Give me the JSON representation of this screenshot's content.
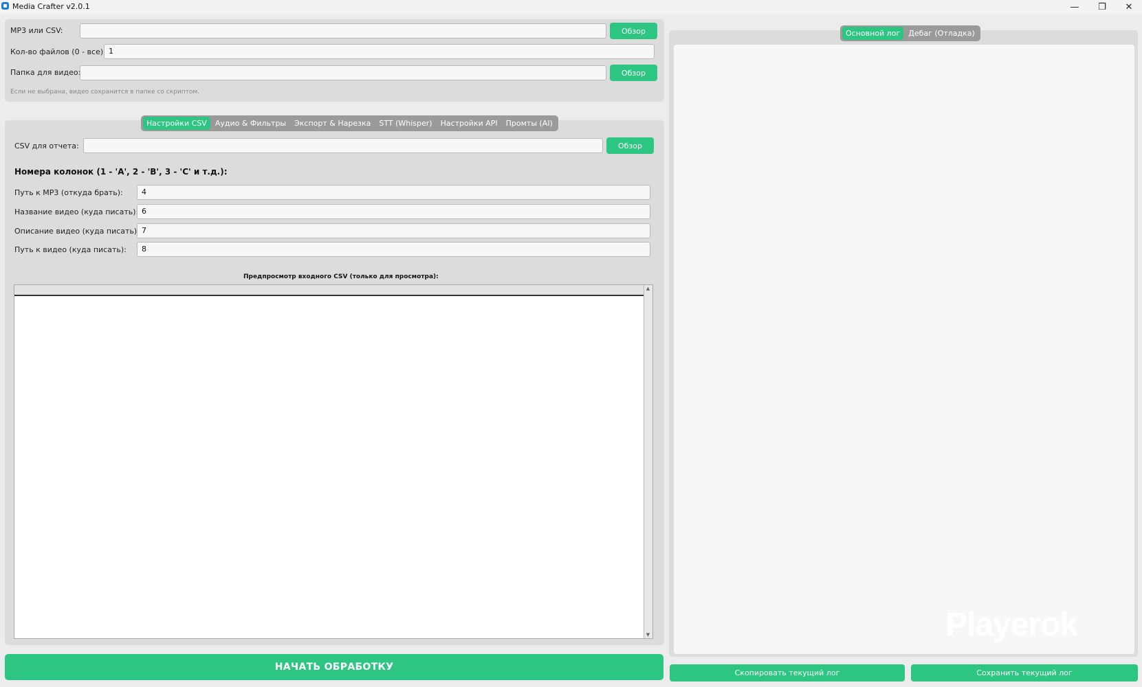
{
  "window": {
    "title": "Media Crafter v2.0.1",
    "minimize": "—",
    "maximize": "❐",
    "close": "✕"
  },
  "files": {
    "mp3_label": "MP3 или CSV:",
    "mp3_value": "",
    "browse": "Обзор",
    "count_label": "Кол-во файлов (0 - все):",
    "count_value": "1",
    "folder_label": "Папка для видео:",
    "folder_value": "",
    "hint": "Если не выбрана, видео сохранится в папке со скриптом."
  },
  "tabs": [
    "Настройки CSV",
    "Аудио & Фильтры",
    "Экспорт & Нарезка",
    "STT (Whisper)",
    "Настройки API",
    "Промты (AI)"
  ],
  "csv": {
    "report_label": "CSV для отчета:",
    "report_value": "",
    "browse": "Обзор",
    "columns_heading": "Номера колонок (1 - 'A', 2 - 'B', 3 - 'C' и т.д.):",
    "fields": [
      {
        "label": "Путь к MP3 (откуда брать):",
        "value": "4"
      },
      {
        "label": "Название видео (куда писать):",
        "value": "6"
      },
      {
        "label": "Описание видео (куда писать):",
        "value": "7"
      },
      {
        "label": "Путь к видео (куда писать):",
        "value": "8"
      }
    ],
    "preview_title": "Предпросмотр входного CSV (только для просмотра):"
  },
  "start_button": "НАЧАТЬ ОБРАБОТКУ",
  "log": {
    "tabs": [
      "Основной лог",
      "Дебаг (Отладка)"
    ],
    "copy_button": "Скопировать текущий лог",
    "save_button": "Сохранить текущий лог"
  },
  "watermark": "Playerok",
  "colors": {
    "accent": "#2cc581",
    "panel": "#dcdcdc",
    "background": "#ececec"
  }
}
